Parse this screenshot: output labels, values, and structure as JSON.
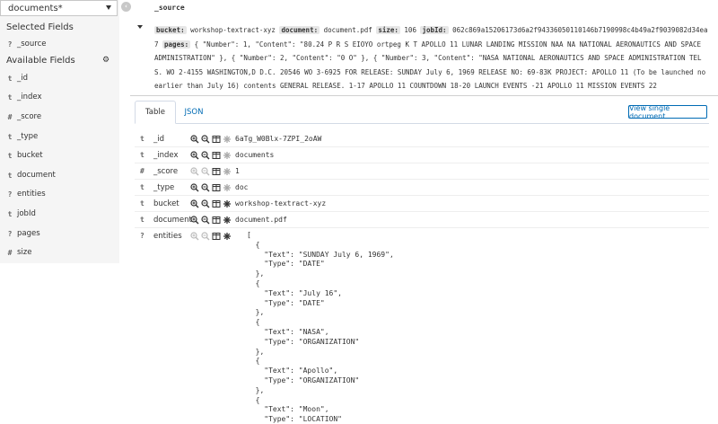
{
  "index_pattern": "documents*",
  "sidebar": {
    "selected_title": "Selected Fields",
    "available_title": "Available Fields",
    "selected": [
      {
        "type": "?",
        "name": "_source"
      }
    ],
    "available": [
      {
        "type": "t",
        "name": "_id"
      },
      {
        "type": "t",
        "name": "_index"
      },
      {
        "type": "#",
        "name": "_score"
      },
      {
        "type": "t",
        "name": "_type"
      },
      {
        "type": "t",
        "name": "bucket"
      },
      {
        "type": "t",
        "name": "document"
      },
      {
        "type": "?",
        "name": "entities"
      },
      {
        "type": "t",
        "name": "jobId"
      },
      {
        "type": "?",
        "name": "pages"
      },
      {
        "type": "#",
        "name": "size"
      }
    ]
  },
  "column_header": "_source",
  "summary": {
    "bucket_key": "bucket:",
    "bucket_val": " workshop-textract-xyz ",
    "document_key": "document:",
    "document_val": " document.pdf ",
    "size_key": "size:",
    "size_val": " 106 ",
    "jobid_key": "jobId:",
    "jobid_val": " 062c869a15206173d6a2f94336050110146b7190998c4b49a2f9039082d34ea7 ",
    "pages_key": "pages:",
    "pages_val": " { \"Number\": 1, \"Content\": \"80.24 P R S EIOYO ortpeg K T APOLLO 11 LUNAR LANDING MISSION NAA NA NATIONAL AERONAUTICS AND SPACE ADMINISTRATION\" }, { \"Number\": 2, \"Content\": \"0 O\" }, { \"Number\": 3, \"Content\": \"NASA NATIONAL AERONAUTICS AND SPACE ADMINISTRATION TELS. WO 2-4155 WASHINGTON,D D.C. 20546 WO 3-6925 FOR RELEASE: SUNDAY July 6, 1969 RELEASE NO: 69-83K PROJECT: APOLLO 11 (To be launched no earlier than July 16) contents GENERAL RELEASE. 1-17 APOLLO 11 COUNTDOWN 18-20 LAUNCH EVENTS -21 APOLLO 11 MISSION EVENTS 22"
  },
  "tabs": {
    "table": "Table",
    "json": "JSON"
  },
  "view_single": "View single document",
  "rows": [
    {
      "type": "t",
      "name": "_id",
      "value": "6aTg_W0Blx-7ZPI_2oAW"
    },
    {
      "type": "t",
      "name": "_index",
      "value": "documents"
    },
    {
      "type": "#",
      "name": "_score",
      "value": "1"
    },
    {
      "type": "t",
      "name": "_type",
      "value": "doc"
    },
    {
      "type": "t",
      "name": "bucket",
      "value": "workshop-textract-xyz"
    },
    {
      "type": "t",
      "name": "document",
      "value": "document.pdf"
    }
  ],
  "entities_row": {
    "type": "?",
    "name": "entities",
    "json": "[\n  {\n    \"Text\": \"SUNDAY July 6, 1969\",\n    \"Type\": \"DATE\"\n  },\n  {\n    \"Text\": \"July 16\",\n    \"Type\": \"DATE\"\n  },\n  {\n    \"Text\": \"NASA\",\n    \"Type\": \"ORGANIZATION\"\n  },\n  {\n    \"Text\": \"Apollo\",\n    \"Type\": \"ORGANIZATION\"\n  },\n  {\n    \"Text\": \"Moon\",\n    \"Type\": \"LOCATION\"\n  },"
  }
}
